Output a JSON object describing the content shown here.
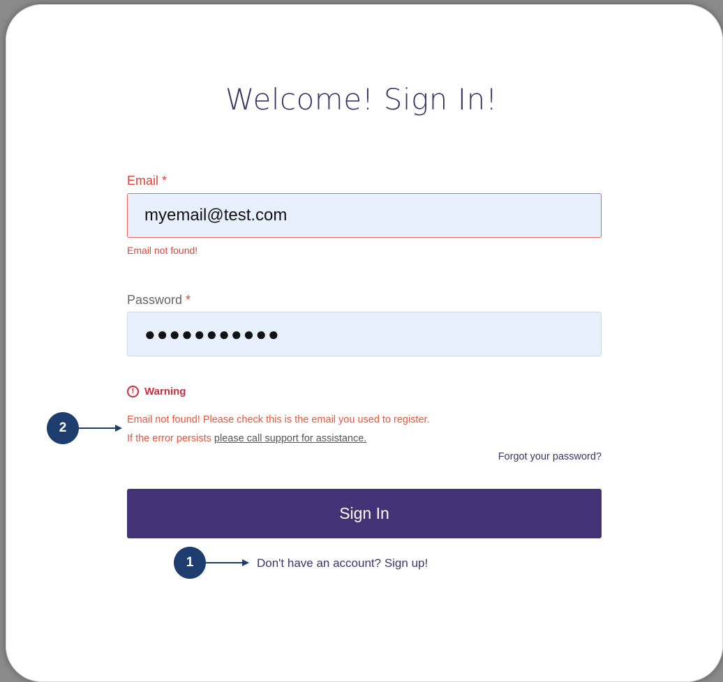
{
  "page": {
    "title": "Welcome! Sign In!"
  },
  "email": {
    "label": "Email",
    "required_mark": "*",
    "value": "myemail@test.com",
    "error": "Email not found!"
  },
  "password": {
    "label": "Password",
    "required_mark": "*",
    "value": "●●●●●●●●●●●"
  },
  "warning": {
    "icon": "!",
    "title": "Warning",
    "line1": "Email not found! Please check this is the email you used to register.",
    "line2_prefix": "If the error persists ",
    "line2_link": "please call support for assistance."
  },
  "forgot_password": "Forgot your password?",
  "sign_in_button": "Sign In",
  "sign_up_link": "Don't have an account? Sign up!",
  "annotations": {
    "marker1": "1",
    "marker2": "2"
  },
  "colors": {
    "accent": "#433275",
    "error": "#e0413a",
    "marker": "#1c3d6e",
    "field_bg": "#e8f0fe"
  }
}
